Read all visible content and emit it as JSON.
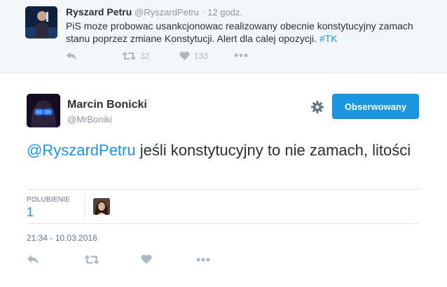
{
  "parent_tweet": {
    "author_name": "Ryszard Petru",
    "author_handle": "@RyszardPetru",
    "separator": "·",
    "time_ago": "12 godz.",
    "text": "PiS moze probowac usankcjonowac realizowany obecnie konstytucyjny zamach stanu poprzez zmiane Konstytucji. Alert dla calej opozycji.",
    "hashtag": "#TK",
    "retweets": "32",
    "likes": "133",
    "icons": [
      "reply-icon",
      "retweet-icon",
      "heart-icon",
      "more-icon"
    ]
  },
  "tweet": {
    "author_name": "Marcin Bonicki",
    "author_handle": "@MrBoniki",
    "follow_label": "Obserwowany",
    "mention": "@RyszardPetru",
    "text": " jeśli konstytucyjny to nie zamach, litości",
    "likes_label": "POLUBIENIE",
    "likes_count": "1",
    "timestamp": "21:34 - 10.03.2016",
    "icons": [
      "gear-icon",
      "reply-icon",
      "retweet-icon",
      "heart-icon",
      "more-icon"
    ]
  },
  "colors": {
    "accent": "#1b95e0",
    "muted_icon": "#aab8c2",
    "parent_background": "#f5f8fa"
  }
}
